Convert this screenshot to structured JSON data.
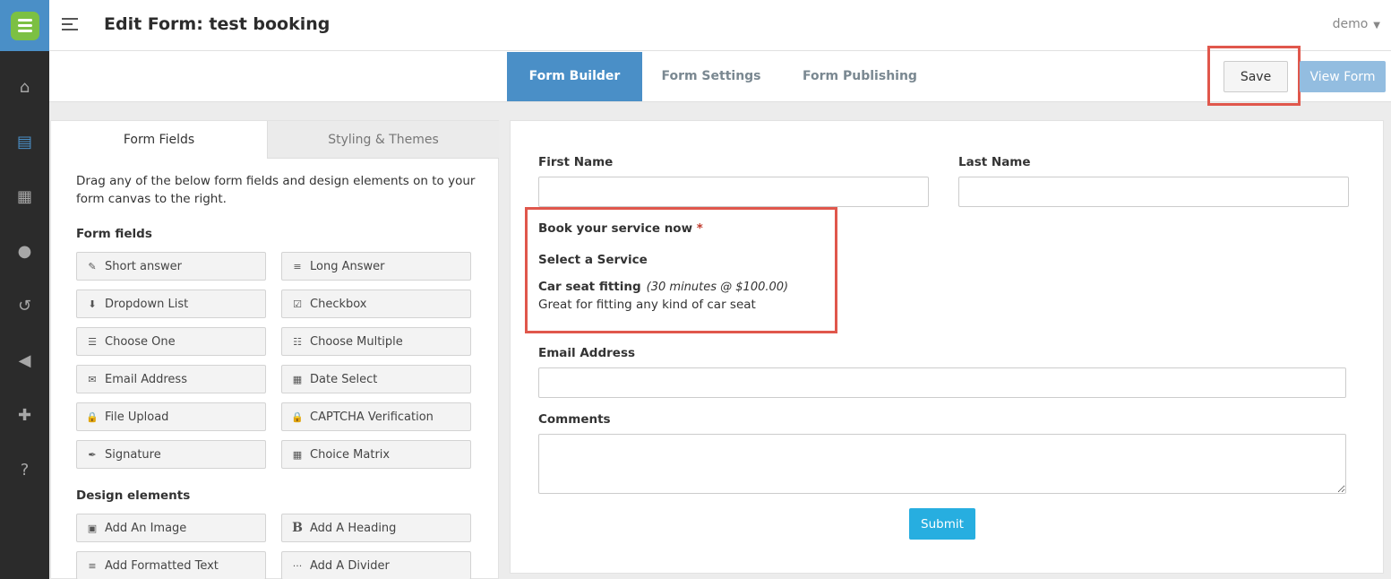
{
  "header": {
    "title": "Edit Form: test booking",
    "user": "demo"
  },
  "sidebar": {
    "items": [
      {
        "icon": "home-icon",
        "glyph": "⌂"
      },
      {
        "icon": "forms-icon",
        "glyph": "▤"
      },
      {
        "icon": "document-icon",
        "glyph": "▦"
      },
      {
        "icon": "user-icon",
        "glyph": "●"
      },
      {
        "icon": "history-icon",
        "glyph": "↺"
      },
      {
        "icon": "megaphone-icon",
        "glyph": "◀"
      },
      {
        "icon": "puzzle-icon",
        "glyph": "✚"
      },
      {
        "icon": "help-icon",
        "glyph": "?"
      }
    ]
  },
  "tabs": {
    "builder": "Form Builder",
    "settings": "Form Settings",
    "publishing": "Form Publishing"
  },
  "toolbar": {
    "save": "Save",
    "view": "View Form"
  },
  "panel": {
    "tab_fields": "Form Fields",
    "tab_styling": "Styling & Themes",
    "intro": "Drag any of the below form fields and design elements on to your form canvas to the right.",
    "fields_heading": "Form fields",
    "design_heading": "Design elements",
    "fields": [
      {
        "label": "Short answer",
        "glyph": "✎"
      },
      {
        "label": "Long Answer",
        "glyph": "≡"
      },
      {
        "label": "Dropdown List",
        "glyph": "⬇"
      },
      {
        "label": "Checkbox",
        "glyph": "☑"
      },
      {
        "label": "Choose One",
        "glyph": "☰"
      },
      {
        "label": "Choose Multiple",
        "glyph": "☷"
      },
      {
        "label": "Email Address",
        "glyph": "✉"
      },
      {
        "label": "Date Select",
        "glyph": "▦"
      },
      {
        "label": "File Upload",
        "glyph": "🔒"
      },
      {
        "label": "CAPTCHA Verification",
        "glyph": "🔒"
      },
      {
        "label": "Signature",
        "glyph": "✒"
      },
      {
        "label": "Choice Matrix",
        "glyph": "▦"
      }
    ],
    "design": [
      {
        "label": "Add An Image",
        "glyph": "▣"
      },
      {
        "label": "Add A Heading",
        "glyph": "B"
      },
      {
        "label": "Add Formatted Text",
        "glyph": "≡"
      },
      {
        "label": "Add A Divider",
        "glyph": "···"
      }
    ]
  },
  "form": {
    "first_name": "First Name",
    "last_name": "Last Name",
    "booking_title": "Book your service now",
    "required_mark": "*",
    "select_service": "Select a Service",
    "service_name": "Car seat fitting",
    "service_meta": "(30 minutes @ $100.00)",
    "service_desc": "Great for fitting any kind of car seat",
    "email": "Email Address",
    "comments": "Comments",
    "submit": "Submit"
  },
  "colors": {
    "accent": "#4a8fc7",
    "highlight": "#e0574c",
    "submit": "#27aee0",
    "rail": "#2b2b2b"
  }
}
